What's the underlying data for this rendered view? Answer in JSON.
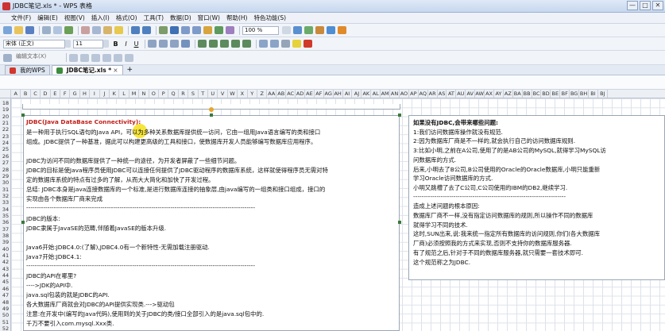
{
  "window": {
    "title": "JDBC笔记.xls * - WPS 表格",
    "buttons": [
      "—",
      "□",
      "✕"
    ]
  },
  "menu": {
    "items": [
      "文件(F)",
      "编辑(E)",
      "视图(V)",
      "插入(I)",
      "格式(O)",
      "工具(T)",
      "数据(D)",
      "窗口(W)",
      "帮助(H)",
      "特色功能(S)"
    ]
  },
  "toolbar": {
    "zoom": "100 %",
    "font": "宋体 (正文)",
    "size": "11",
    "bold": "B",
    "italic": "I",
    "underline": "U",
    "edit_label": "编辑文本(X)"
  },
  "tabs": [
    {
      "label": "我的WPS",
      "active": false
    },
    {
      "label": "JDBC笔记.xls *",
      "active": true
    }
  ],
  "columns": [
    "A",
    "B",
    "C",
    "D",
    "E",
    "F",
    "G",
    "H",
    "I",
    "J",
    "K",
    "L",
    "M",
    "N",
    "O",
    "P",
    "Q",
    "R",
    "S",
    "T",
    "U",
    "V",
    "W",
    "X",
    "Y",
    "Z",
    "AA",
    "AB",
    "AC",
    "AD",
    "AE",
    "AF",
    "AG",
    "AH",
    "AI",
    "AJ",
    "AK",
    "AL",
    "AM",
    "AN",
    "AO",
    "AP",
    "AQ",
    "AR",
    "AS",
    "AT",
    "AU",
    "AV",
    "AW",
    "AX",
    "AY",
    "AZ",
    "BA",
    "BB",
    "BC",
    "BD",
    "BE",
    "BF",
    "BG",
    "BH",
    "BI",
    "BJ"
  ],
  "rows": [
    "18",
    "19",
    "20",
    "21",
    "22",
    "23",
    "24",
    "25",
    "26",
    "27",
    "28",
    "29",
    "30",
    "31",
    "32",
    "33",
    "34",
    "35",
    "36",
    "37",
    "38",
    "39",
    "40",
    "41",
    "42",
    "43",
    "44",
    "45",
    "46",
    "47",
    "48",
    "49",
    "50",
    "51",
    "52"
  ],
  "left_note": [
    "JDBC(Java DataBase Connectivity):",
    "     是一种用于执行SQL语句的Java API，可以为多种关系数据库提供统一访问，它由一组用Java语言编写的类和接口",
    "组成。JDBC提供了一种基准，据此可以构建更高级的工具和接口，使数据库开发人员能够编写数据库应用程序。",
    "",
    "    JDBC为访问不同的数据库提供了一种统一的途径，为开发者屏蔽了一些细节问题。",
    "JDBC的目标是使Java程序员使用JDBC可以连接任何提供了JDBC驱动程序的数据库系统，这样就使得程序员无需对特",
    "定的数据库系统的特点有过多的了解，从而大大简化和加快了开发过程。",
    "     总结: JDBC本身是java连接数据库的一个标准,是进行数据库连接的抽象层,由java编写的一组类和接口组成，接口的",
    "实现由各个数据库厂商来完成",
    "------------------------------------------------------------------------------------------------------------",
    "JDBC的版本:",
    "   JDBC隶属于JavaSE的范畴,伴随着JavaSE的版本升级.",
    "",
    "Java6开始:JDBC4.0:(了解),JDBC4.0有一个新特性-无需加载注册驱动.",
    "Java7开始:JDBC4.1:",
    "------------------------------------------------------------------------------------------------------------",
    "JDBC的API在哪里?",
    "    ---->JDK的API中.",
    "        java.sql包装的就是JDBC的API.",
    "        各大数据库厂商就会对JDBC的API提供实现类.--->驱动包",
    "   注意:在开发中(编写的Java代码),使用到的关于JDBC的类/接口全部引入的是java.sql包中的.",
    "          千万不要引入com.mysql.Xxx类."
  ],
  "right_note": [
    "如果没有JDBC,会带来哪些问题:",
    "  1:我们访问数据库操作就没有规范.",
    "  2:因为数据库厂商是不一样的,就会执行自己的访问数据库规则.",
    "  3:比如小明,之前在A公司,使用了的是AB公司的MySQL,就得学习MySQL访",
    "问数据库的方式.",
    "     后来,小明去了B公司,B公司使用的Oracle的Oracle数据库,小明只能重新",
    "学习Oracle访问数据库的方式.",
    "     小明又跳槽了去了C公司,C公司使用的IBM的DB2,继续学习.",
    "------------------------------------------------------------------------",
    "造成上述问题的根本原因:",
    " 数据库厂商不一样,没有指定访问数据库的规则,所以操作不同的数据库",
    " 就得学习不同的技术.",
    " 这时,SUN出来,说:我来统一指定所有数据库的访问规则,你们(各大数据库",
    " 厂商)必须按照我的方式来实现,否则不支持你的数据库服务器.",
    "  有了规范之后,针对于不同的数据库服务器,就只需要一套技术即可.",
    "  这个规范称之为JDBC."
  ]
}
